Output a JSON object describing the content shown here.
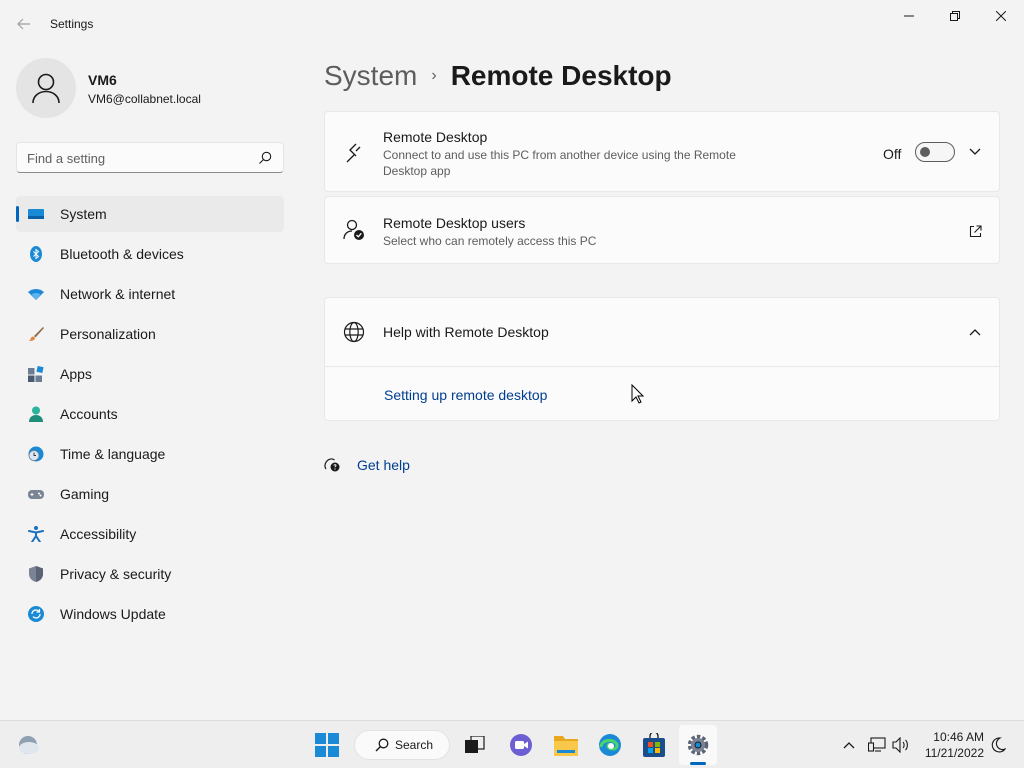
{
  "window": {
    "title": "Settings"
  },
  "profile": {
    "name": "VM6",
    "email": "VM6@collabnet.local"
  },
  "search": {
    "placeholder": "Find a setting"
  },
  "sidebar": {
    "items": [
      {
        "label": "System",
        "icon": "system-icon",
        "selected": true
      },
      {
        "label": "Bluetooth & devices",
        "icon": "bluetooth-icon"
      },
      {
        "label": "Network & internet",
        "icon": "wifi-icon"
      },
      {
        "label": "Personalization",
        "icon": "brush-icon"
      },
      {
        "label": "Apps",
        "icon": "apps-icon"
      },
      {
        "label": "Accounts",
        "icon": "accounts-icon"
      },
      {
        "label": "Time & language",
        "icon": "clock-globe-icon"
      },
      {
        "label": "Gaming",
        "icon": "gamepad-icon"
      },
      {
        "label": "Accessibility",
        "icon": "accessibility-icon"
      },
      {
        "label": "Privacy & security",
        "icon": "shield-icon"
      },
      {
        "label": "Windows Update",
        "icon": "update-icon"
      }
    ]
  },
  "breadcrumb": {
    "parent": "System",
    "separator": "›",
    "current": "Remote Desktop"
  },
  "remote_desktop": {
    "title": "Remote Desktop",
    "description": "Connect to and use this PC from another device using the Remote Desktop app",
    "toggle_label": "Off",
    "enabled": false
  },
  "remote_users": {
    "title": "Remote Desktop users",
    "description": "Select who can remotely access this PC"
  },
  "help": {
    "title": "Help with Remote Desktop",
    "link": "Setting up remote desktop"
  },
  "get_help": {
    "label": "Get help"
  },
  "taskbar": {
    "search_label": "Search",
    "time": "10:46 AM",
    "date": "11/21/2022"
  },
  "colors": {
    "accent": "#0067c0",
    "link": "#003e92",
    "background": "#f3f3f3",
    "card": "#fbfbfb"
  }
}
